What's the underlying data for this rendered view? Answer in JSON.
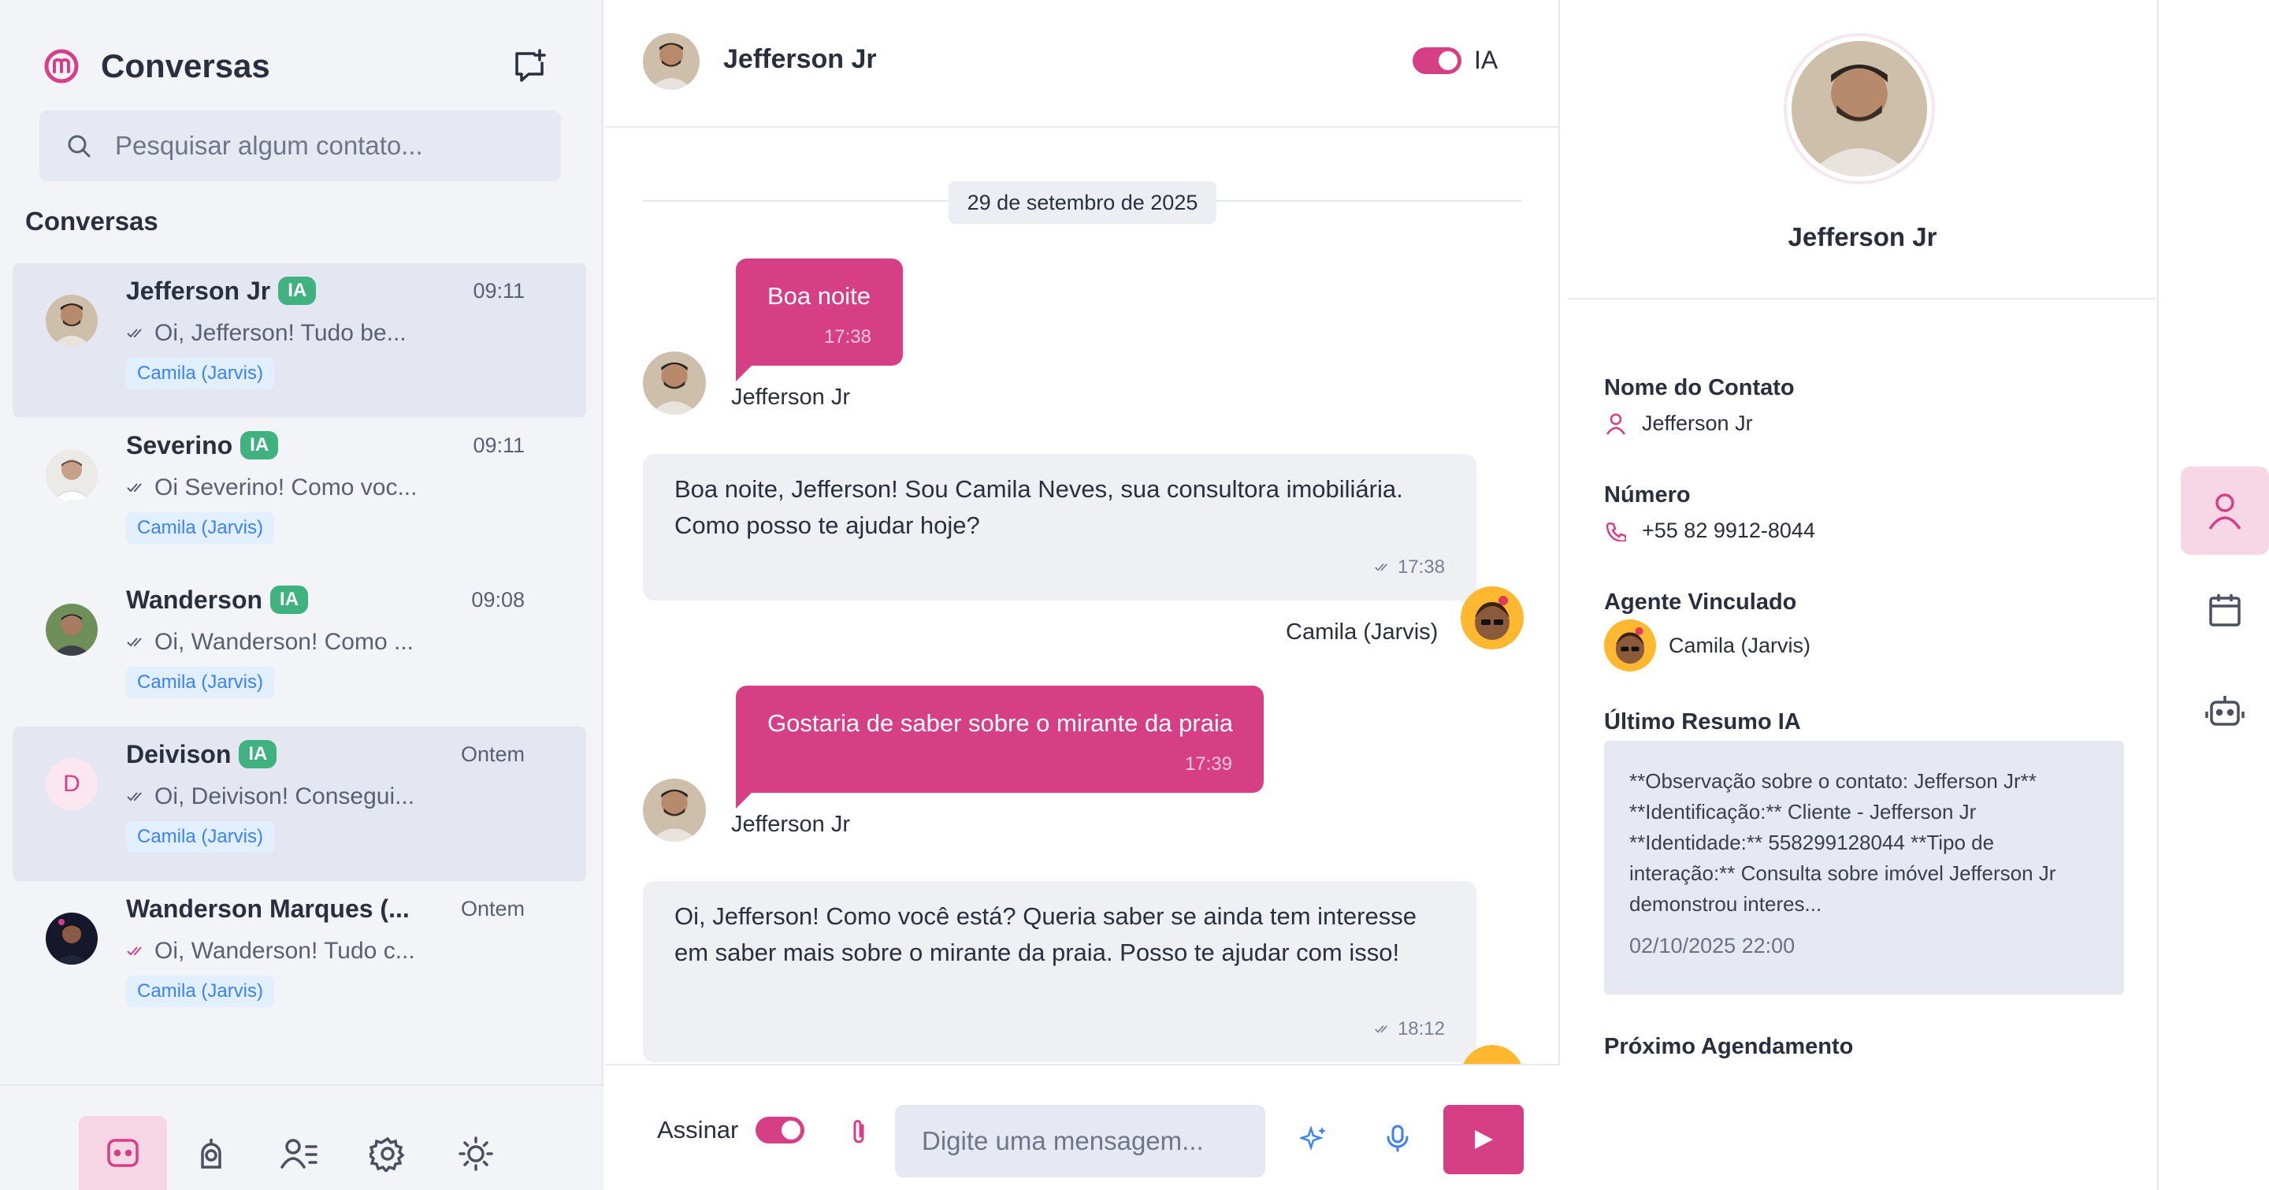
{
  "app": {
    "title": "Conversas",
    "accent": "#d63f86",
    "ia_badge_color": "#3fb27f",
    "agent_tag_color": "#3b82f6"
  },
  "search": {
    "placeholder": "Pesquisar algum contato..."
  },
  "sidebar": {
    "section_title": "Conversas",
    "conversations": [
      {
        "name": "Jefferson Jr",
        "ia": "IA",
        "time": "09:11",
        "preview": "Oi, Jefferson! Tudo be...",
        "agent": "Camila (Jarvis)",
        "active": true
      },
      {
        "name": "Severino",
        "ia": "IA",
        "time": "09:11",
        "preview": "Oi Severino! Como voc...",
        "agent": "Camila (Jarvis)",
        "active": false
      },
      {
        "name": "Wanderson",
        "ia": "IA",
        "time": "09:08",
        "preview": "Oi, Wanderson! Como ...",
        "agent": "Camila (Jarvis)",
        "active": false
      },
      {
        "name": "Deivison",
        "ia": "IA",
        "time": "Ontem",
        "preview": "Oi, Deivison! Consegui...",
        "agent": "Camila (Jarvis)",
        "active": true,
        "initial": "D"
      },
      {
        "name": "Wanderson Marques (...",
        "ia": "",
        "time": "Ontem",
        "preview": "Oi, Wanderson! Tudo c...",
        "agent": "Camila (Jarvis)",
        "active": false
      }
    ],
    "bottom_nav": [
      "chat-icon",
      "camera-icon",
      "users-list-icon",
      "gear-icon",
      "sun-icon"
    ]
  },
  "chat": {
    "contact_name": "Jefferson Jr",
    "ia_label": "IA",
    "date_separator": "29 de setembro de 2025",
    "messages": [
      {
        "dir": "out",
        "text": "Boa noite",
        "time": "17:38",
        "sender": "Jefferson Jr"
      },
      {
        "dir": "in",
        "text": "Boa noite, Jefferson! Sou Camila Neves, sua consultora imobiliária. Como posso te ajudar hoje?",
        "time": "17:38",
        "sender": "Camila (Jarvis)"
      },
      {
        "dir": "out",
        "text": "Gostaria de saber sobre o mirante da praia",
        "time": "17:39",
        "sender": "Jefferson Jr"
      },
      {
        "dir": "in",
        "text": "Oi, Jefferson! Como você está? Queria saber se ainda tem interesse em saber mais sobre o mirante da praia. Posso te ajudar com isso!",
        "time": "18:12",
        "sender": ""
      }
    ],
    "footer": {
      "assinar_label": "Assinar",
      "input_placeholder": "Digite uma mensagem..."
    }
  },
  "contact": {
    "name": "Jefferson Jr",
    "fields": {
      "name_label": "Nome do Contato",
      "name_value": "Jefferson Jr",
      "number_label": "Número",
      "number_value": "+55 82 9912-8044",
      "agent_label": "Agente Vinculado",
      "agent_value": "Camila (Jarvis)",
      "summary_label": "Último Resumo IA",
      "summary_text": "**Observação sobre o contato: Jefferson Jr** **Identificação:** Cliente - Jefferson Jr **Identidade:** 558299128044 **Tipo de interação:** Consulta sobre imóvel Jefferson Jr demonstrou interes...",
      "summary_date": "02/10/2025 22:00",
      "next_label": "Próximo Agendamento"
    }
  },
  "rail": {
    "items": [
      "user-icon",
      "calendar-icon",
      "robot-icon"
    ]
  }
}
